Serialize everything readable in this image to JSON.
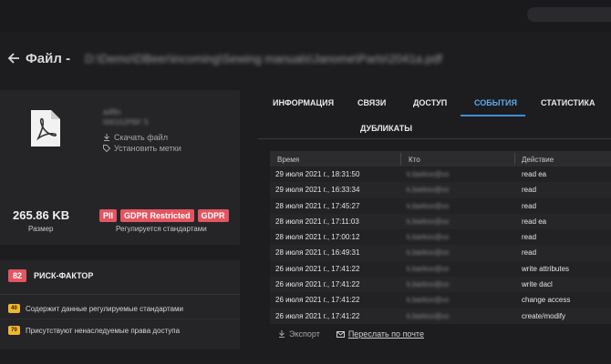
{
  "header": {
    "title_label": "Файл -",
    "file_path": "D:\\Demo\\DBeer\\incoming\\Sewing manuals\\Janome\\Parts\\2041a.pdf"
  },
  "file_card": {
    "name": "a4fin",
    "sub": "000152PBF S",
    "download_label": "Скачать файл",
    "labels_label": "Установить метки",
    "size_value": "265.86 KB",
    "size_label": "Размер",
    "badges": [
      "PII",
      "GDPR Restricted",
      "GDPR"
    ],
    "badges_label": "Регулируется стандартами"
  },
  "risk": {
    "score": "82",
    "title": "РИСК-ФАКТОР",
    "items": [
      {
        "score": "40",
        "label": "Содержит данные регулируемые стандартами"
      },
      {
        "score": "70",
        "label": "Присутствуют ненаследуемые права доступа"
      }
    ]
  },
  "tabs": [
    {
      "label": "ИНФОРМАЦИЯ"
    },
    {
      "label": "СВЯЗИ"
    },
    {
      "label": "ДОСТУП"
    },
    {
      "label": "СОБЫТИЯ"
    },
    {
      "label": "СТАТИСТИКА"
    },
    {
      "label": "ДУБЛИКАТЫ"
    }
  ],
  "table": {
    "columns": [
      "Время",
      "Кто",
      "Действие"
    ],
    "rows": [
      {
        "time": "29 июля 2021 г., 18:31:50",
        "who": "k.barkov@xx",
        "action": "read ea"
      },
      {
        "time": "29 июля 2021 г., 16:33:34",
        "who": "k.barkov@xx",
        "action": "read"
      },
      {
        "time": "28 июля 2021 г., 17:45:27",
        "who": "k.barkov@xx",
        "action": "read"
      },
      {
        "time": "28 июля 2021 г., 17:11:03",
        "who": "k.barkov@xx",
        "action": "read ea"
      },
      {
        "time": "28 июля 2021 г., 17:00:12",
        "who": "k.barkov@xx",
        "action": "read"
      },
      {
        "time": "28 июля 2021 г., 16:49:31",
        "who": "k.barkov@xx",
        "action": "read"
      },
      {
        "time": "26 июля 2021 г., 17:41:22",
        "who": "k.barkov@xx",
        "action": "write attributes"
      },
      {
        "time": "26 июля 2021 г., 17:41:22",
        "who": "k.barkov@xx",
        "action": "write dacl"
      },
      {
        "time": "26 июля 2021 г., 17:41:22",
        "who": "k.barkov@xx",
        "action": "change access"
      },
      {
        "time": "26 июля 2021 г., 17:41:22",
        "who": "k.barkov@xx",
        "action": "create/modify"
      }
    ]
  },
  "footer": {
    "export_label": "Экспорт",
    "email_label": "Переслать по почте"
  },
  "colors": {
    "accent": "#3d8fd6",
    "badge_red": "#e35561",
    "badge_yellow": "#f2b630",
    "background": "#1d1d20"
  }
}
